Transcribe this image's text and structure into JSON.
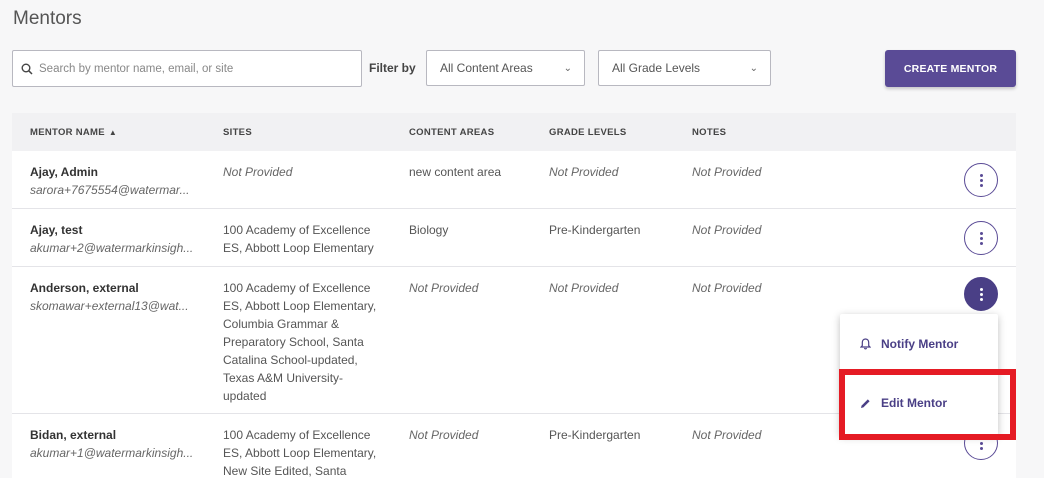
{
  "page": {
    "title": "Mentors"
  },
  "toolbar": {
    "search_placeholder": "Search by mentor name, email, or site",
    "filter_label": "Filter by",
    "content_area_selected": "All Content Areas",
    "grade_level_selected": "All Grade Levels",
    "create_label": "CREATE MENTOR"
  },
  "table": {
    "headers": {
      "name": "MENTOR NAME",
      "sites": "SITES",
      "content": "CONTENT AREAS",
      "grade": "GRADE LEVELS",
      "notes": "NOTES"
    },
    "sort_icon": "sort-ascending-icon",
    "rows": [
      {
        "name": "Ajay, Admin",
        "email": "sarora+7675554@watermar...",
        "sites": [
          "Not Provided"
        ],
        "content": "new content area",
        "grade": "Not Provided",
        "notes": "Not Provided"
      },
      {
        "name": "Ajay, test",
        "email": "akumar+2@watermarkinsigh...",
        "sites": [
          "100 Academy of Excellence",
          "ES, Abbott Loop Elementary"
        ],
        "content": "Biology",
        "grade": "Pre-Kindergarten",
        "notes": "Not Provided"
      },
      {
        "name": "Anderson, external",
        "email": "skomawar+external13@wat...",
        "sites": [
          "100 Academy of Excellence",
          "ES, Abbott Loop Elementary,",
          "Columbia Grammar &",
          "Preparatory School, Santa",
          "Catalina School-updated,",
          "Texas A&M University-",
          "updated"
        ],
        "content": "Not Provided",
        "grade": "Not Provided",
        "notes": "Not Provided"
      },
      {
        "name": "Bidan, external",
        "email": "akumar+1@watermarkinsigh...",
        "sites": [
          "100 Academy of Excellence",
          "ES, Abbott Loop Elementary,",
          "New Site Edited, Santa"
        ],
        "content": "Not Provided",
        "grade": "Pre-Kindergarten",
        "notes": "Not Provided"
      }
    ]
  },
  "menu": {
    "notify_label": "Notify Mentor",
    "notify_icon": "bell-icon",
    "edit_label": "Edit Mentor",
    "edit_icon": "pencil-icon"
  },
  "colors": {
    "accent": "#5a4b96",
    "highlight": "#e51b24"
  }
}
